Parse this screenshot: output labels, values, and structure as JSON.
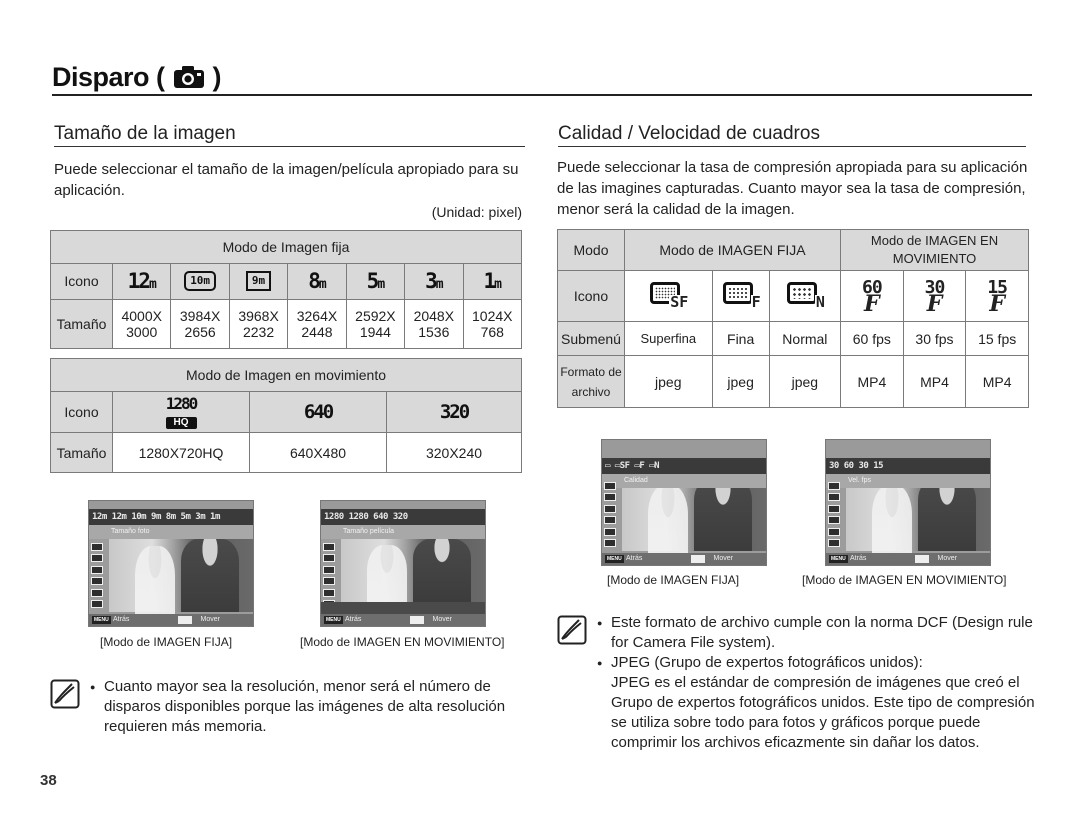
{
  "page": {
    "title": "Disparo (",
    "title_close": ")",
    "title_icon": "camera-icon",
    "page_number": "38"
  },
  "left": {
    "section_title": "Tamaño de la imagen",
    "intro": "Puede seleccionar el tamaño de la imagen/película apropiado para su aplicación.",
    "unit": "(Unidad: pixel)",
    "still_table": {
      "header": "Modo de Imagen fija",
      "row_icon_label": "Icono",
      "row_size_label": "Tamaño",
      "columns": [
        {
          "icon": "12m",
          "icon_name": "12m-icon",
          "size_w": "4000X",
          "size_h": "3000"
        },
        {
          "icon": "10m",
          "icon_name": "10m-wide-icon",
          "size_w": "3984X",
          "size_h": "2656"
        },
        {
          "icon": "9m",
          "icon_name": "9m-wide-icon",
          "size_w": "3968X",
          "size_h": "2232"
        },
        {
          "icon": "8m",
          "icon_name": "8m-icon",
          "size_w": "3264X",
          "size_h": "2448"
        },
        {
          "icon": "5m",
          "icon_name": "5m-icon",
          "size_w": "2592X",
          "size_h": "1944"
        },
        {
          "icon": "3m",
          "icon_name": "3m-icon",
          "size_w": "2048X",
          "size_h": "1536"
        },
        {
          "icon": "1m",
          "icon_name": "1m-icon",
          "size_w": "1024X",
          "size_h": "768"
        }
      ]
    },
    "movie_table": {
      "header": "Modo de Imagen en movimiento",
      "row_icon_label": "Icono",
      "row_size_label": "Tamaño",
      "columns": [
        {
          "icon": "1280",
          "badge": "HQ",
          "size": "1280X720HQ"
        },
        {
          "icon": "640",
          "size": "640X480"
        },
        {
          "icon": "320",
          "size": "320X240"
        }
      ]
    },
    "screens": [
      {
        "caption": "[Modo de IMAGEN FIJA]",
        "topbar": "12m 12m 10m 9m 8m 5m 3m 1m",
        "label": "Tamaño foto",
        "back": "Atrás",
        "move": "Mover",
        "menu": "MENU"
      },
      {
        "caption": "[Modo de IMAGEN EN MOVIMIENTO]",
        "topbar": "1280 1280 640 320",
        "label": "Tamaño película",
        "back": "Atrás",
        "move": "Mover",
        "menu": "MENU"
      }
    ],
    "note": "Cuanto mayor sea la resolución, menor será el número de disparos disponibles porque las imágenes de alta resolución requieren más memoria."
  },
  "right": {
    "section_title": "Calidad / Velocidad de cuadros",
    "intro": "Puede seleccionar la tasa de compresión apropiada para su aplicación de las imagines capturadas. Cuanto mayor sea la tasa de compresión, menor será la calidad de la imagen.",
    "table": {
      "mode_label": "Modo",
      "still_mode": "Modo de IMAGEN FIJA",
      "movie_mode_line1": "Modo de IMAGEN EN",
      "movie_mode_line2": "MOVIMIENTO",
      "icon_label": "Icono",
      "submenu_label": "Submenú",
      "format_label_line1": "Formato de",
      "format_label_line2": "archivo",
      "columns": [
        {
          "icon": "SF",
          "icon_name": "superfine-icon",
          "submenu": "Superfina",
          "format": "jpeg"
        },
        {
          "icon": "F",
          "icon_name": "fine-icon",
          "submenu": "Fina",
          "format": "jpeg"
        },
        {
          "icon": "N",
          "icon_name": "normal-icon",
          "submenu": "Normal",
          "format": "jpeg"
        },
        {
          "icon": "60",
          "icon_name": "60fps-icon",
          "submenu": "60 fps",
          "format": "MP4"
        },
        {
          "icon": "30",
          "icon_name": "30fps-icon",
          "submenu": "30 fps",
          "format": "MP4"
        },
        {
          "icon": "15",
          "icon_name": "15fps-icon",
          "submenu": "15 fps",
          "format": "MP4"
        }
      ]
    },
    "screens": [
      {
        "caption": "[Modo de IMAGEN FIJA]",
        "topbar": "▭ ▭SF ▭F ▭N",
        "label": "Calidad",
        "back": "Atrás",
        "move": "Mover",
        "menu": "MENU"
      },
      {
        "caption": "[Modo de IMAGEN EN MOVIMIENTO]",
        "topbar": "30 60 30 15",
        "label": "Vel. fps",
        "back": "Atrás",
        "move": "Mover",
        "menu": "MENU"
      }
    ],
    "notes": [
      "Este formato de archivo cumple con la norma DCF (Design rule for Camera File system).",
      "JPEG (Grupo de expertos fotográficos unidos):",
      "JPEG es el estándar de compresión de imágenes que creó el Grupo de expertos fotográficos unidos. Este tipo de compresión se utiliza sobre todo para fotos y gráficos porque puede comprimir los archivos eficazmente sin dañar los datos."
    ]
  }
}
